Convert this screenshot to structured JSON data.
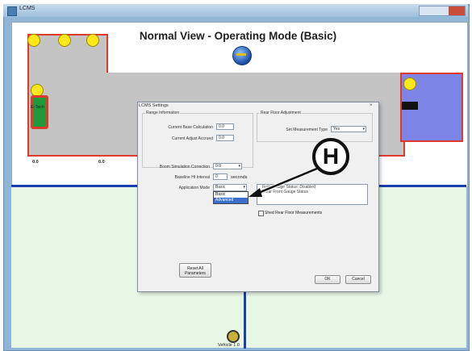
{
  "window": {
    "title": "LCMS",
    "controls_label": "— ▢ ✕"
  },
  "view": {
    "heading": "Normal View - Operating Mode (Basic)",
    "left_labels": [
      "0.0",
      "0.0"
    ],
    "unit_label": "E-Tech",
    "vehicle_label": "Vehicle 1.0"
  },
  "dialog": {
    "title": "LCMS Settings",
    "close": "×",
    "group_left_title": "Range Information",
    "group_right_title": "Rear Floor Adjustment",
    "fields": [
      {
        "label": "Current Base Calculation",
        "value": "0.0"
      },
      {
        "label": "Current Adjust Accrued",
        "value": "0.0"
      },
      {
        "label": "Boom Simulation Correction",
        "value": "0.0"
      },
      {
        "label": "Baseline Ht Interval",
        "value": "0",
        "unit": "seconds"
      },
      {
        "label": "Application Mode",
        "value": "Basic"
      }
    ],
    "right_combo_label": "Set Measurement Type",
    "right_combo_value": "Yes",
    "dropdown_options": [
      "Basic",
      "Advanced"
    ],
    "dropdown_selected": 1,
    "listbox_lines": [
      "Front Gauge Status: Disabled",
      "Clear Front Gauge Status"
    ],
    "checkbox_label": "Shed Rear Floor Measurements",
    "reset_button": "Reset All Parameters",
    "ok_button": "OK",
    "cancel_button": "Cancel"
  },
  "callout": {
    "letter": "H"
  },
  "colors": {
    "outline_red": "#e03a2c",
    "machine_gray": "#c4c4c4",
    "blue_end": "#7d86e6",
    "lower_green": "#e8f6e6",
    "divider_blue": "#1a3fb0",
    "dot_yellow": "#ffe81a"
  }
}
